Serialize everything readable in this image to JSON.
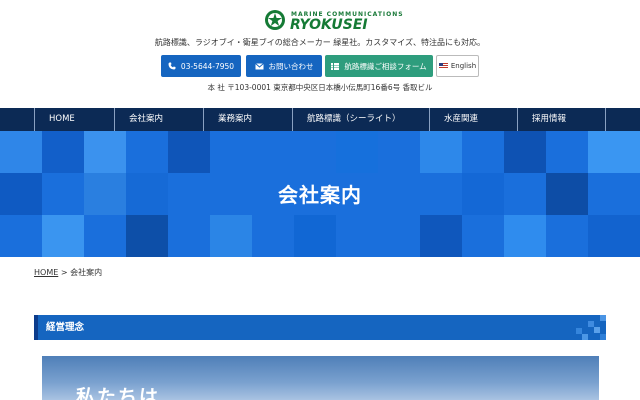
{
  "header": {
    "logo_small": "MARINE COMMUNICATIONS",
    "logo_big": "RYOKUSEI",
    "tagline": "航路標識、ラジオブイ・衛星ブイの総合メーカー 緑星社。カスタマイズ、特注品にも対応。",
    "address": "本 社 〒103-0001 東京都中央区日本橋小伝馬町16番6号 香取ビル"
  },
  "buttons": {
    "phone": "03-5644-7950",
    "contact": "お問い合わせ",
    "form": "航路標識ご相談フォーム",
    "english": "English"
  },
  "nav": {
    "items": [
      "HOME",
      "会社案内",
      "業務案内",
      "航路標識（シーライト）",
      "水産関連",
      "採用情報"
    ]
  },
  "hero": {
    "title": "会社案内"
  },
  "breadcrumb": {
    "home": "HOME",
    "separator": ">",
    "current": "会社案内"
  },
  "section": {
    "title": "経営理念",
    "photo_text": "私たちは"
  },
  "colors": {
    "nav_bg": "#0c2a55",
    "primary_blue": "#1565c0",
    "form_green": "#2e9d7d",
    "logo_green": "#157a35"
  }
}
